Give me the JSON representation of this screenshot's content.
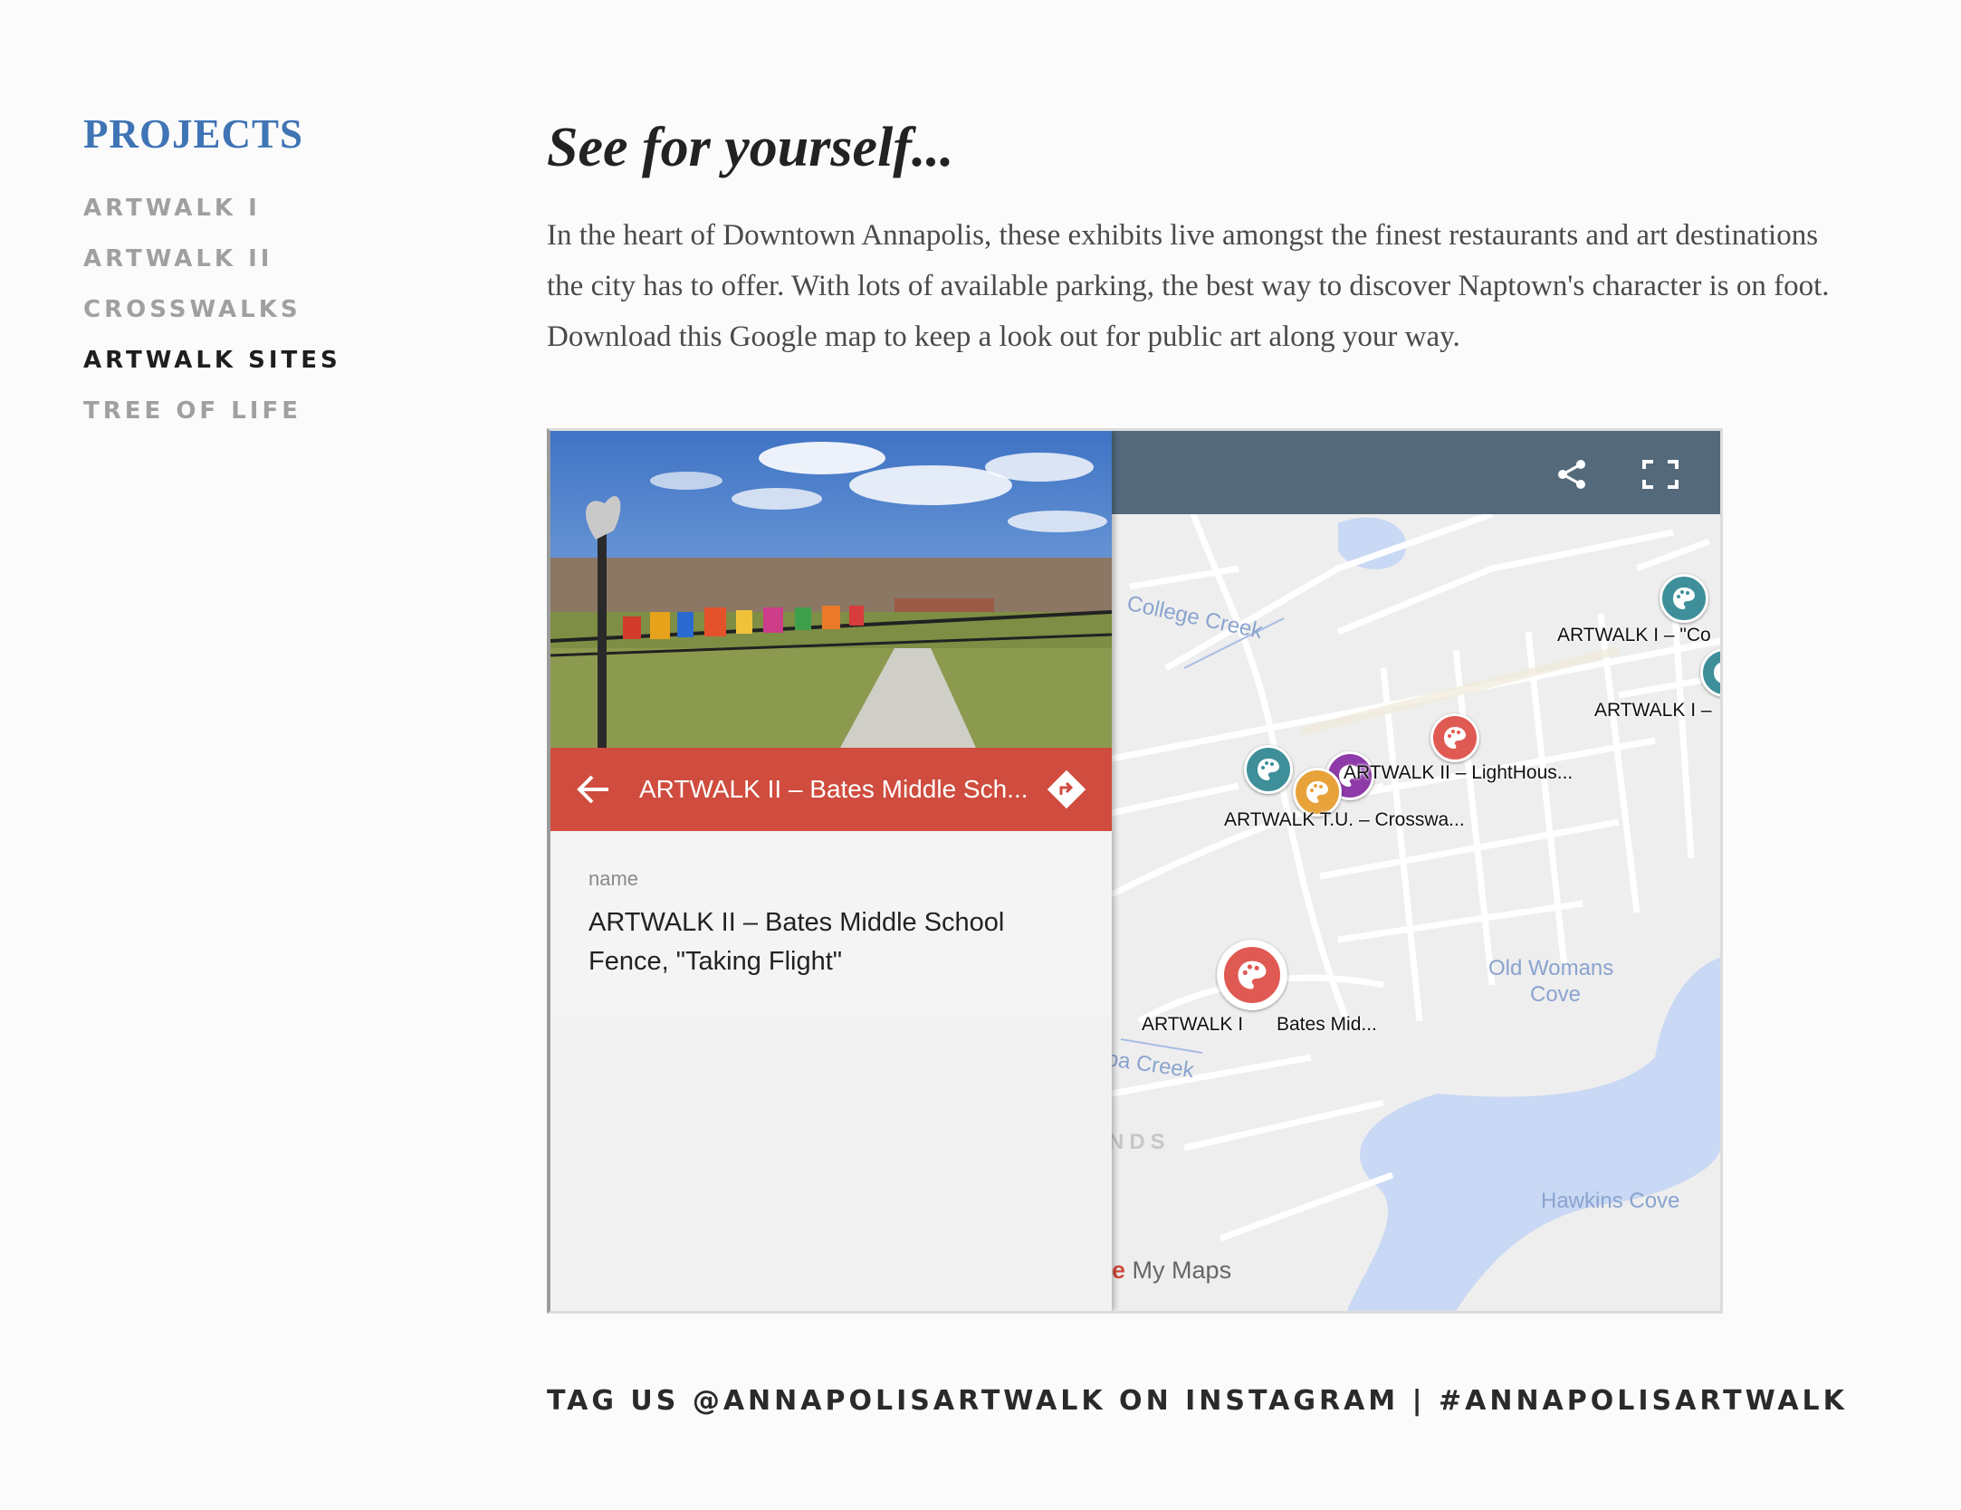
{
  "sidebar": {
    "heading": "PROJECTS",
    "items": [
      {
        "label": "ARTWALK I",
        "active": false
      },
      {
        "label": "ARTWALK II",
        "active": false
      },
      {
        "label": "CROSSWALKS",
        "active": false
      },
      {
        "label": "ARTWALK SITES",
        "active": true
      },
      {
        "label": "TREE OF LIFE",
        "active": false
      }
    ]
  },
  "main": {
    "title": "See for yourself...",
    "intro": "In the heart of Downtown Annapolis, these exhibits live amongst the finest restaurants and art destinations the city has to offer. With lots of available parking, the best way to discover Naptown's character is on foot. Download this Google map to keep a look out for public art along your way."
  },
  "map_embed": {
    "panel_title": "ARTWALK II – Bates Middle Sch...",
    "field_label": "name",
    "field_value": "ARTWALK II – Bates Middle School Fence, \"Taking Flight\"",
    "toolbar_color": "#546a7b",
    "header_color": "#cf4c3e",
    "icons": [
      "back-arrow-icon",
      "directions-icon",
      "share-icon",
      "fullscreen-icon",
      "palette-icon"
    ],
    "water_labels": {
      "college_creek": "College Creek",
      "old_womans_cove_1": "Old Womans",
      "old_womans_cove_2": "Cove",
      "spa_creek": "pa Creek",
      "hawkins_cove": "Hawkins Cove",
      "area": "NDS"
    },
    "pin_labels": {
      "artwalk1_a": "ARTWALK I – \"Co",
      "artwalk1_b": "ARTWALK I –",
      "lighthouse": "ARTWALK II – LightHous...",
      "crosswalk": "ARTWALK T.U. – Crosswa...",
      "bates_a": "ARTWALK I",
      "bates_b": "Bates Mid..."
    },
    "branding_e": "e",
    "branding": "My Maps"
  },
  "footer": {
    "text": "TAG US @ANNAPOLISARTWALK ON INSTAGRAM | #ANNAPOLISARTWALK"
  }
}
